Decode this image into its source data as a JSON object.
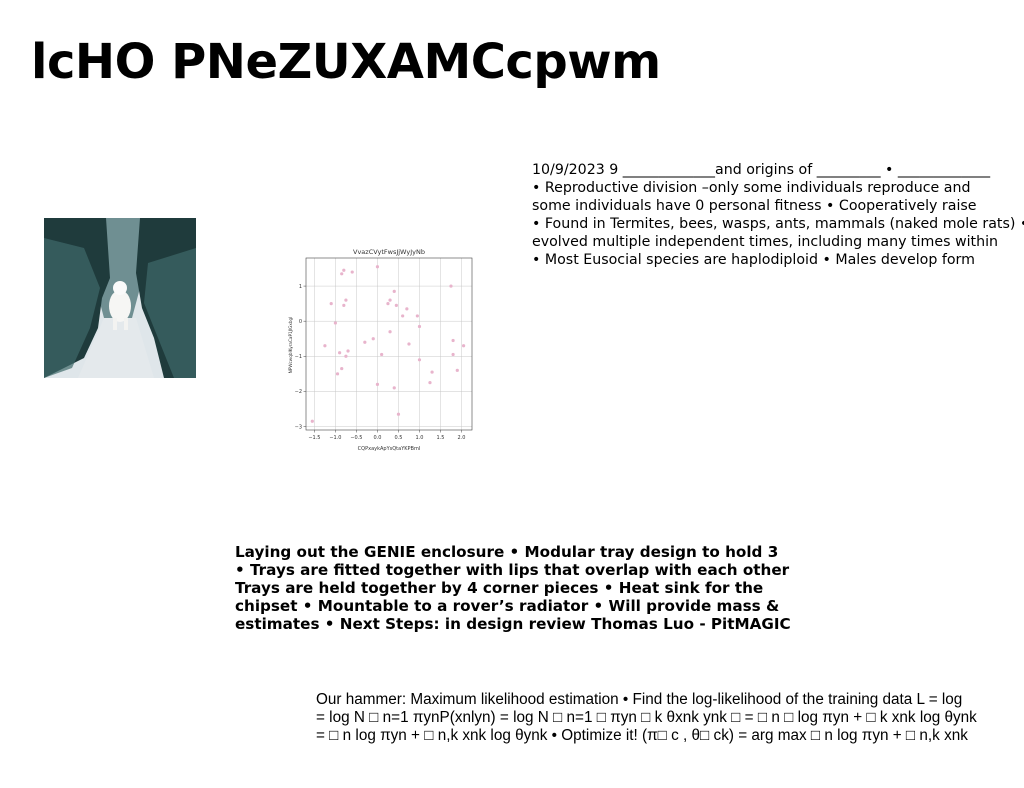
{
  "page": {
    "title": "lcHO PNeZUXAMCcpwm"
  },
  "text_block_1": {
    "lines": [
      "10/9/2023 9 _____________and origins of _________ • _____________",
      "• Reproductive division –only some individuals reproduce and",
      "some individuals have 0 personal fitness • Cooperatively raise",
      "• Found in Termites, bees, wasps, ants, mammals (naked mole rats) •",
      "evolved multiple independent times, including many times within",
      "• Most Eusocial species are haplodiploid • Males develop form"
    ]
  },
  "text_block_2": {
    "lines": [
      "Laying out the GENIE enclosure • Modular tray design to hold 3",
      "• Trays are fitted together with lips that overlap with each other",
      "Trays are held together by 4 corner pieces • Heat sink for the",
      "chipset • Mountable to a rover’s radiator • Will provide mass &",
      "estimates • Next Steps: in design review Thomas Luo - PitMAGIC"
    ]
  },
  "text_block_3": {
    "lines": [
      "Our hammer: Maximum likelihood estimation • Find the log-likelihood of the training data L = log",
      "= log N □ n=1 πynP(xnlyn) = log N □ n=1 □ πyn □ k θxnk ynk □ = □ n □ log πyn + □ k xnk log θynk",
      "= □ n log πyn + □ n,k xnk log θynk • Optimize it! (π□ c , θ□ ck) = arg max □ n log πyn + □ n,k xnk"
    ]
  },
  "photo": {
    "icon": "dog-in-snowy-forest-photo"
  },
  "colors": {
    "marker": "#e8b4cc",
    "grid": "#c8c8c8",
    "axis": "#444444",
    "forest_dark": "#1f3b3c",
    "forest_mid": "#3f6a6a",
    "snow": "#dfe6ea"
  },
  "chart_data": {
    "type": "scatter",
    "title": "VvazCVytFwsJjWyJyNb",
    "xlabel": "CQPxaykApYsQtaYKPBmI",
    "ylabel": "NPWcwqbIKyraCaP1JIGxbgl",
    "xlim": [
      -1.7,
      2.25
    ],
    "ylim": [
      -3.1,
      1.8
    ],
    "xticks": [
      -1.5,
      -1.0,
      -0.5,
      0.0,
      0.5,
      1.0,
      1.5,
      2.0
    ],
    "xtick_labels": [
      "−1.5",
      "−1.0",
      "−0.5",
      "0.0",
      "0.5",
      "1.0",
      "1.5",
      "2.0"
    ],
    "yticks": [
      -3,
      -2,
      -1,
      0,
      1
    ],
    "ytick_labels": [
      "−3",
      "−2",
      "−1",
      "0",
      "1"
    ],
    "grid": true,
    "points": [
      [
        -1.55,
        -2.85
      ],
      [
        -1.25,
        -0.7
      ],
      [
        -1.1,
        0.5
      ],
      [
        -1.0,
        -0.05
      ],
      [
        -0.95,
        -1.5
      ],
      [
        -0.9,
        -0.9
      ],
      [
        -0.85,
        -1.35
      ],
      [
        -0.8,
        0.45
      ],
      [
        -0.75,
        0.6
      ],
      [
        -0.8,
        1.45
      ],
      [
        -0.85,
        1.35
      ],
      [
        -0.75,
        -1.0
      ],
      [
        -0.7,
        -0.85
      ],
      [
        -0.6,
        1.4
      ],
      [
        -0.3,
        -0.6
      ],
      [
        -0.1,
        -0.5
      ],
      [
        0.0,
        1.55
      ],
      [
        0.0,
        -1.8
      ],
      [
        0.1,
        -0.95
      ],
      [
        0.25,
        0.5
      ],
      [
        0.3,
        0.6
      ],
      [
        0.3,
        -0.3
      ],
      [
        0.4,
        0.85
      ],
      [
        0.4,
        -1.9
      ],
      [
        0.45,
        0.45
      ],
      [
        0.5,
        -2.65
      ],
      [
        0.6,
        0.15
      ],
      [
        0.7,
        0.35
      ],
      [
        0.75,
        -0.65
      ],
      [
        0.95,
        0.15
      ],
      [
        1.0,
        -1.1
      ],
      [
        1.0,
        -0.15
      ],
      [
        1.25,
        -1.75
      ],
      [
        1.3,
        -1.45
      ],
      [
        1.75,
        1.0
      ],
      [
        1.8,
        -0.55
      ],
      [
        1.8,
        -0.95
      ],
      [
        1.9,
        -1.4
      ],
      [
        2.05,
        -0.7
      ]
    ]
  }
}
